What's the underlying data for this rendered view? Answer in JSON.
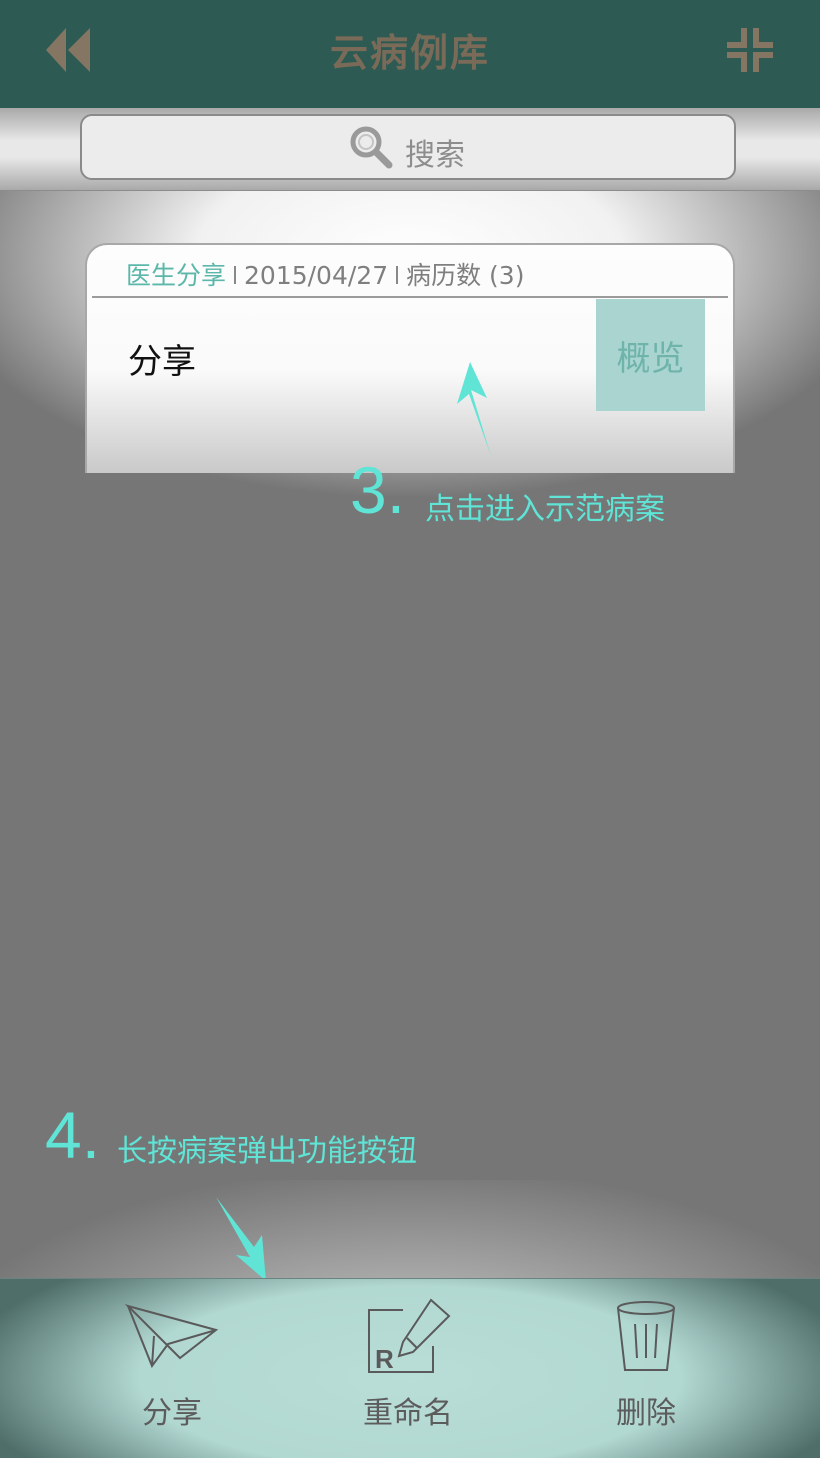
{
  "header": {
    "title": "云病例库",
    "back_icon": "double-chevron-left-icon",
    "collapse_icon": "collapse-icon"
  },
  "search": {
    "placeholder": "搜索",
    "icon": "search-icon"
  },
  "card": {
    "source": "医生分享",
    "date": "2015/04/27",
    "record_count": "病历数 (3)",
    "title": "分享",
    "overview_label": "概览"
  },
  "hints": {
    "step3": {
      "number": "3.",
      "text": "点击进入示范病案"
    },
    "step4": {
      "number": "4.",
      "text": "长按病案弹出功能按钮"
    }
  },
  "bottom_bar": {
    "items": [
      {
        "label": "分享",
        "icon": "paper-plane-icon"
      },
      {
        "label": "重命名",
        "icon": "rename-pencil-icon"
      },
      {
        "label": "删除",
        "icon": "trash-icon"
      }
    ]
  },
  "colors": {
    "header": "#2e5a54",
    "accent": "#5fe4d6",
    "overlay": "#767676",
    "bottom_bar": "#b9ddd7"
  }
}
